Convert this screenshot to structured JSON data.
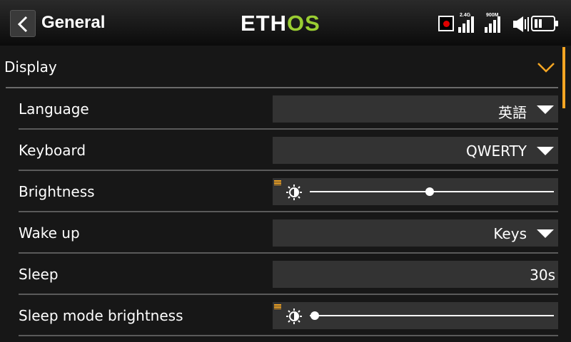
{
  "header": {
    "title": "General",
    "logo": {
      "part1": "ETH",
      "part2": "OS"
    },
    "signals": [
      {
        "label": "2.4G"
      },
      {
        "label": "900M"
      }
    ],
    "colors": {
      "accent": "#f5a623",
      "logo_green": "#9acd32",
      "record": "#e00000"
    }
  },
  "section": {
    "title": "Display",
    "expanded": true
  },
  "rows": [
    {
      "label": "Language",
      "value": "英語",
      "type": "dropdown"
    },
    {
      "label": "Keyboard",
      "value": "QWERTY",
      "type": "dropdown"
    },
    {
      "label": "Brightness",
      "type": "slider",
      "level": 0.49
    },
    {
      "label": "Wake up",
      "value": "Keys",
      "type": "dropdown"
    },
    {
      "label": "Sleep",
      "value": "30s",
      "type": "number"
    },
    {
      "label": "Sleep mode brightness",
      "type": "slider",
      "level": 0.02
    }
  ],
  "icons": [
    "back-arrow-icon",
    "record-icon",
    "signal-icon",
    "speaker-icon",
    "battery-icon",
    "chevron-down-icon",
    "brightness-icon",
    "menu-icon"
  ]
}
